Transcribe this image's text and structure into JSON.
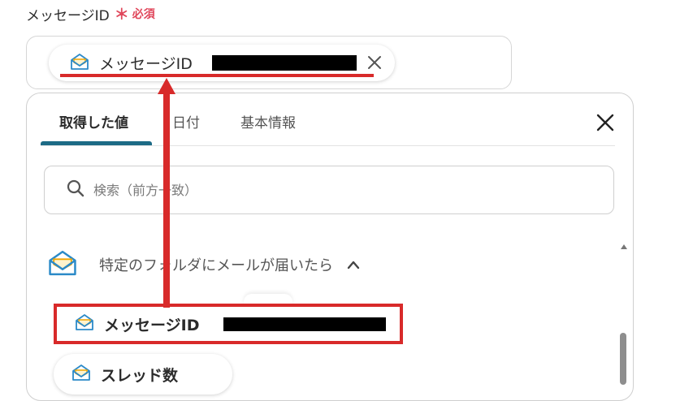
{
  "field": {
    "label": "メッセージID",
    "required_mark": "＊",
    "required_text": "必須",
    "chip_label": "メッセージID"
  },
  "panel": {
    "tabs": [
      {
        "label": "取得した値",
        "active": true
      },
      {
        "label": "日付",
        "active": false
      },
      {
        "label": "基本情報",
        "active": false
      }
    ],
    "search_placeholder": "検索（前方一致）",
    "section_title": "特定のフォルダにメールが届いたら",
    "items": [
      {
        "label": "メッセージID",
        "highlighted": true
      },
      {
        "label": "スレッド数",
        "highlighted": false
      }
    ]
  },
  "colors": {
    "accent": "#1d6b86",
    "required": "#e0475b",
    "annotation": "#d82a2a",
    "icon_blue": "#2b8ac8",
    "icon_orange": "#f0a500"
  },
  "icons": [
    "mail-envelope-icon",
    "close-icon",
    "search-icon",
    "chevron-up-icon",
    "scroll-up-arrow-icon"
  ]
}
